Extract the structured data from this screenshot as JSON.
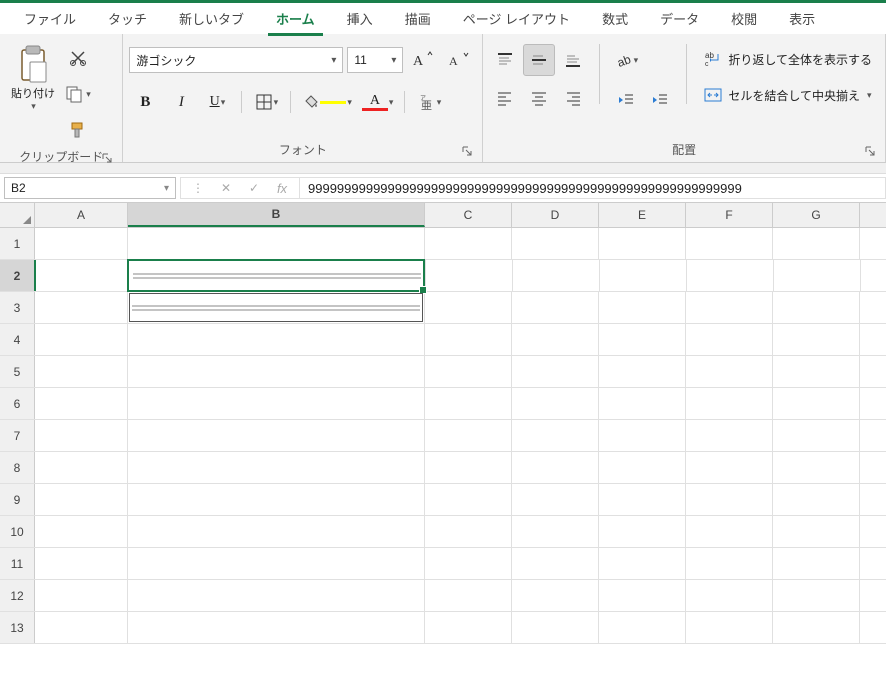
{
  "tabs": {
    "items": [
      "ファイル",
      "タッチ",
      "新しいタブ",
      "ホーム",
      "挿入",
      "描画",
      "ページ レイアウト",
      "数式",
      "データ",
      "校閲",
      "表示"
    ],
    "active_index": 3
  },
  "ribbon": {
    "clipboard": {
      "paste_label": "貼り付け",
      "group_label": "クリップボード"
    },
    "font": {
      "name": "游ゴシック",
      "size": "11",
      "group_label": "フォント",
      "buttons": {
        "bold": "B",
        "italic": "I",
        "underline": "U"
      }
    },
    "alignment": {
      "group_label": "配置",
      "wrap_label": "折り返して全体を表示する",
      "merge_label": "セルを結合して中央揃え"
    }
  },
  "formula_bar": {
    "cell_ref": "B2",
    "formula": "999999999999999999999999999999999999999999999999999999999999"
  },
  "grid": {
    "col_widths": {
      "A": 92,
      "B": 296,
      "C": 86,
      "D": 86,
      "E": 86,
      "F": 86,
      "G": 86
    },
    "columns": [
      "A",
      "B",
      "C",
      "D",
      "E",
      "F",
      "G"
    ],
    "rows": [
      "1",
      "2",
      "3",
      "4",
      "5",
      "6",
      "7",
      "8",
      "9",
      "10",
      "11",
      "12",
      "13"
    ],
    "selected_col": "B",
    "selected_row": "2"
  }
}
